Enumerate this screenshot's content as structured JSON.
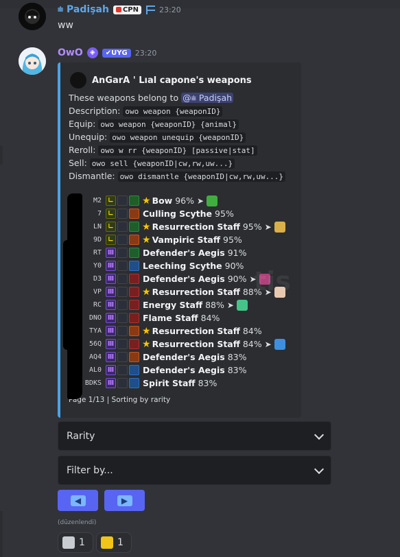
{
  "message1": {
    "username": "⩧ Padişah",
    "tag": "CPN",
    "time": "23:20",
    "text": "ww"
  },
  "message2": {
    "username": "OwO",
    "bot_badge": "✔UYG",
    "time": "23:20",
    "edited": "(düzenlendi)"
  },
  "embed": {
    "author": "AnGarA ' Lıal capone's weapons",
    "belong_text": "These weapons belong to",
    "belong_mention": "@⩧ Padişah",
    "lines": [
      {
        "label": "Description:",
        "code": "owo weapon {weaponID}"
      },
      {
        "label": "Equip:",
        "code": "owo weapon {weaponID} {animal}"
      },
      {
        "label": "Unequip:",
        "code": "owo weapon unequip {weaponID}"
      },
      {
        "label": "Reroll:",
        "code": "owo w rr {weaponID} [passive|stat]"
      },
      {
        "label": "Sell:",
        "code": "owo sell {weaponID|cw,rw,uw...}"
      },
      {
        "label": "Dismantle:",
        "code": "owo dismantle {weaponID|cw,rw,uw...}"
      }
    ],
    "weapons": [
      {
        "id": "M2",
        "rarity": "L",
        "star": true,
        "name": "Bow",
        "pct": "96%",
        "passive": "g",
        "animal": "#3fae3f"
      },
      {
        "id": "7",
        "rarity": "L",
        "star": false,
        "name": "Culling Scythe",
        "pct": "95%",
        "passive": "o",
        "animal": ""
      },
      {
        "id": "LN",
        "rarity": "L",
        "star": true,
        "name": "Resurrection Staff",
        "pct": "95%",
        "passive": "g",
        "animal": "#d8b04a"
      },
      {
        "id": "9D",
        "rarity": "L",
        "star": true,
        "name": "Vampiric Staff",
        "pct": "95%",
        "passive": "o",
        "animal": ""
      },
      {
        "id": "RT",
        "rarity": "M",
        "star": false,
        "name": "Defender's Aegis",
        "pct": "91%",
        "passive": "g",
        "animal": ""
      },
      {
        "id": "Y0",
        "rarity": "M",
        "star": false,
        "name": "Leeching Scythe",
        "pct": "90%",
        "passive": "b",
        "animal": ""
      },
      {
        "id": "D3",
        "rarity": "M",
        "star": false,
        "name": "Defender's Aegis",
        "pct": "90%",
        "passive": "r",
        "animal": "#b0417a"
      },
      {
        "id": "VP",
        "rarity": "M",
        "star": true,
        "name": "Resurrection Staff",
        "pct": "88%",
        "passive": "r",
        "animal": "#e8c9b0"
      },
      {
        "id": "RC",
        "rarity": "M",
        "star": false,
        "name": "Energy Staff",
        "pct": "88%",
        "passive": "r",
        "animal": "#45c48a"
      },
      {
        "id": "DNO",
        "rarity": "M",
        "star": false,
        "name": "Flame Staff",
        "pct": "84%",
        "passive": "r",
        "animal": ""
      },
      {
        "id": "TYA",
        "rarity": "M",
        "star": true,
        "name": "Resurrection Staff",
        "pct": "84%",
        "passive": "o",
        "animal": ""
      },
      {
        "id": "56Q",
        "rarity": "M",
        "star": true,
        "name": "Resurrection Staff",
        "pct": "84%",
        "passive": "r",
        "animal": "#3f8fe0"
      },
      {
        "id": "AQ4",
        "rarity": "M",
        "star": false,
        "name": "Defender's Aegis",
        "pct": "83%",
        "passive": "o",
        "animal": ""
      },
      {
        "id": "AL0",
        "rarity": "M",
        "star": false,
        "name": "Defender's Aegis",
        "pct": "83%",
        "passive": "b",
        "animal": ""
      },
      {
        "id": "BDKS",
        "rarity": "M",
        "star": false,
        "name": "Spirit Staff",
        "pct": "83%",
        "passive": "b",
        "animal": ""
      }
    ],
    "footer": "Page 1/13 | Sorting by rarity"
  },
  "selects": {
    "sort_value": "Rarity",
    "filter_placeholder": "Filter by..."
  },
  "buttons": {
    "prev_icon": "arrow-left-icon",
    "next_icon": "arrow-right-icon"
  },
  "reactions": [
    {
      "icon": "toolbox-icon",
      "count": "1",
      "color": "#c9ccd1"
    },
    {
      "icon": "bar-chart-icon",
      "count": "1",
      "color": "#f0c419"
    }
  ],
  "colors": {
    "background": "#313338",
    "embed_bg": "#2b2d31",
    "embed_accent": "#4aa3e8",
    "button": "#5865f2"
  }
}
